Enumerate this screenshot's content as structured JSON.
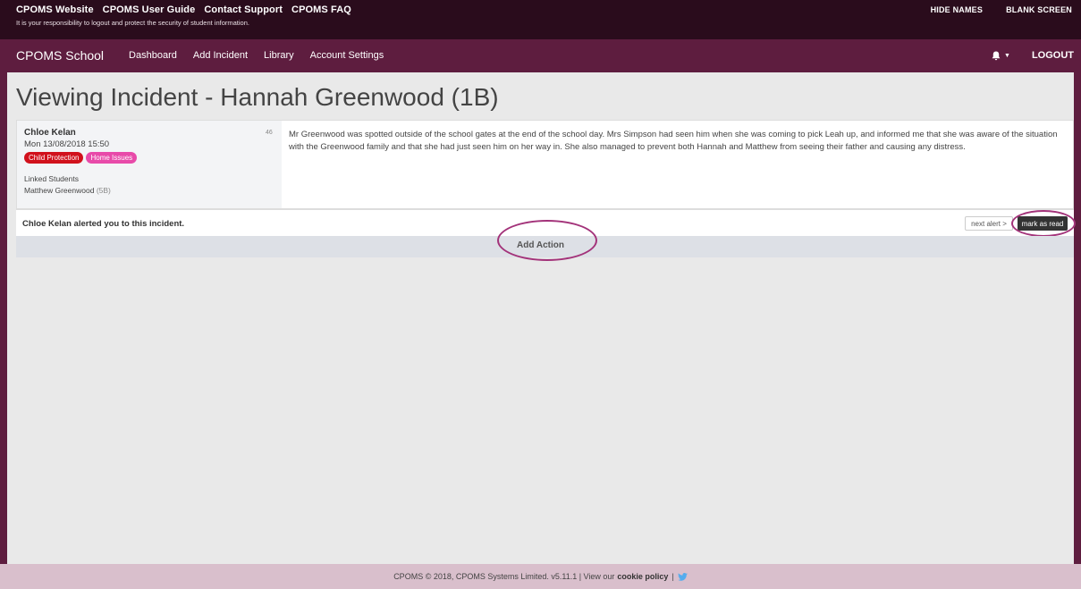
{
  "topbar": {
    "links": [
      "CPOMS Website",
      "CPOMS User Guide",
      "Contact Support",
      "CPOMS FAQ"
    ],
    "note": "It is your responsibility to logout and protect the security of student information.",
    "hide_names": "HIDE NAMES",
    "blank_screen": "BLANK SCREEN"
  },
  "navbar": {
    "brand": "CPOMS School",
    "links": [
      "Dashboard",
      "Add Incident",
      "Library",
      "Account Settings"
    ],
    "notifications_icon": "bell-icon",
    "logout": "LOGOUT"
  },
  "page": {
    "title": "Viewing Incident - Hannah Greenwood (1B)"
  },
  "incident": {
    "author": "Chloe Kelan",
    "datetime": "Mon 13/08/2018 15:50",
    "tags": [
      "Child Protection",
      "Home Issues"
    ],
    "linked_label": "Linked Students",
    "linked_student": "Matthew Greenwood",
    "linked_class": "(5B)",
    "count": "46",
    "text": "Mr Greenwood was spotted outside of the school gates at the end of the school day. Mrs Simpson had seen him when she was coming to pick Leah up, and informed me that she was aware of the situation with the Greenwood family and that she had just seen him on her way in. She also managed to prevent both Hannah and Matthew from seeing their father and causing any distress."
  },
  "alert": {
    "text": "Chloe Kelan alerted you to this incident.",
    "next_alert": "next alert >",
    "mark_as_read": "mark as read"
  },
  "actions": {
    "add_action": "Add Action"
  },
  "footer": {
    "text": "CPOMS © 2018, CPOMS Systems Limited. v5.11.1 | View our",
    "cookie_policy": "cookie policy",
    "separator": "|",
    "twitter_icon": "twitter-icon"
  },
  "colors": {
    "topbar": "#2a0c1c",
    "navbar": "#5e1d3f",
    "child_protection": "#d1111c",
    "home_issues": "#e84aa9",
    "annotation_ring": "#a3337a"
  }
}
